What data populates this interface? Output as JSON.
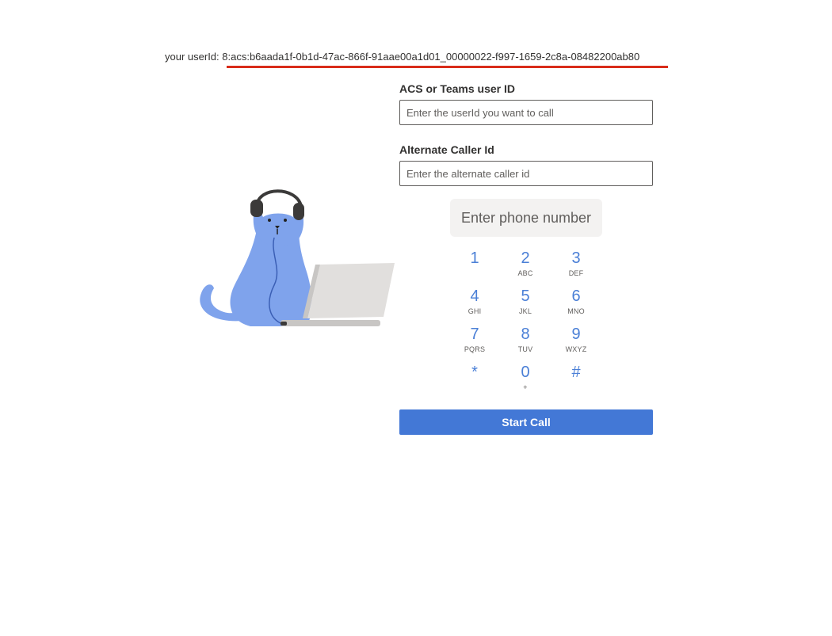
{
  "userid": {
    "label": "your userId: ",
    "value": "8:acs:b6aada1f-0b1d-47ac-866f-91aae00a1d01_00000022-f997-1659-2c8a-08482200ab80"
  },
  "form": {
    "user_id_label": "ACS or Teams user ID",
    "user_id_placeholder": "Enter the userId you want to call",
    "alt_caller_label": "Alternate Caller Id",
    "alt_caller_placeholder": "Enter the alternate caller id",
    "phone_placeholder": "Enter phone number"
  },
  "dialpad": {
    "keys": [
      {
        "digit": "1",
        "letters": ""
      },
      {
        "digit": "2",
        "letters": "ABC"
      },
      {
        "digit": "3",
        "letters": "DEF"
      },
      {
        "digit": "4",
        "letters": "GHI"
      },
      {
        "digit": "5",
        "letters": "JKL"
      },
      {
        "digit": "6",
        "letters": "MNO"
      },
      {
        "digit": "7",
        "letters": "PQRS"
      },
      {
        "digit": "8",
        "letters": "TUV"
      },
      {
        "digit": "9",
        "letters": "WXYZ"
      },
      {
        "digit": "*",
        "letters": ""
      },
      {
        "digit": "0",
        "letters": "+"
      },
      {
        "digit": "#",
        "letters": ""
      }
    ]
  },
  "start_call_label": "Start Call",
  "colors": {
    "accent": "#4378d6",
    "dial_digit": "#4a7fd6",
    "underline": "#d92c1a",
    "cat": "#7fa3ec"
  },
  "illustration": "cat-with-headphones-and-laptop"
}
